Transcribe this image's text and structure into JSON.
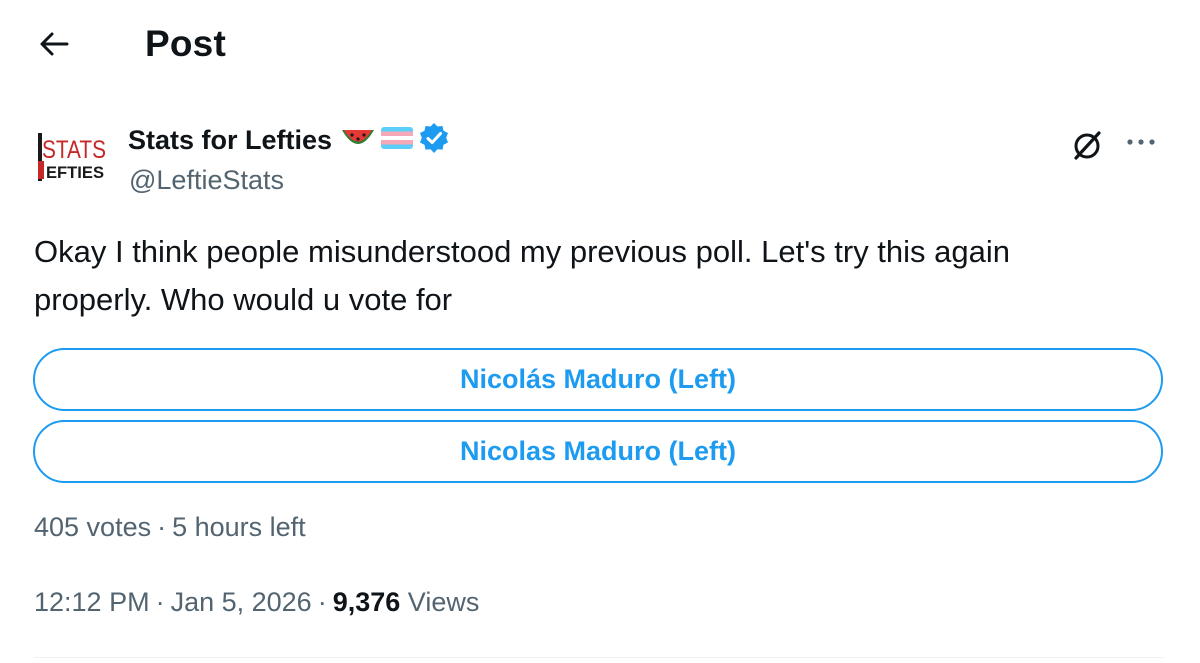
{
  "header": {
    "title": "Post",
    "back_icon": "arrow-left-icon"
  },
  "author": {
    "name": "Stats for Lefties",
    "handle": "@LeftieStats",
    "avatar_text_top": "STATS",
    "avatar_text_bottom": "EFTIES",
    "emojis": [
      "watermelon-icon",
      "trans-flag-icon"
    ],
    "verified": true,
    "verified_color": "#1d9bf0"
  },
  "post": {
    "text_line1": "Okay I think people misunderstood my previous poll. Let's try this again",
    "text_line2": "properly. Who would u vote for"
  },
  "poll": {
    "options": [
      {
        "label": "Nicolás Maduro (Left)"
      },
      {
        "label": "Nicolas Maduro (Left)"
      }
    ],
    "votes": "405 votes",
    "time_left": "5 hours left"
  },
  "meta": {
    "time": "12:12 PM",
    "date": "Jan 5, 2026",
    "views_count": "9,376",
    "views_label": "Views"
  },
  "colors": {
    "accent": "#1d9bf0",
    "text_primary": "#0f1419",
    "text_secondary": "#536471"
  }
}
